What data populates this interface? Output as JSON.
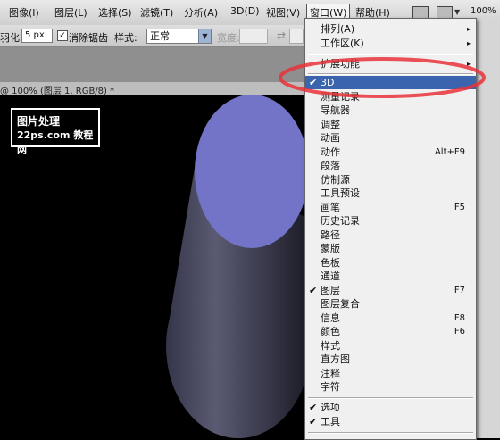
{
  "menubar": {
    "items": [
      "图像(I)",
      "图层(L)",
      "选择(S)",
      "滤镜(T)",
      "分析(A)",
      "3D(D)",
      "视图(V)",
      "窗口(W)",
      "帮助(H)"
    ],
    "zoom": "100%"
  },
  "options": {
    "feather_label": "羽化:",
    "feather_value": "5 px",
    "antialias_label": "消除锯齿",
    "antialias_checked": "✓",
    "style_label": "样式:",
    "style_value": "正常",
    "width_label": "宽度:"
  },
  "document": {
    "tab_title": "@ 100% (图层 1, RGB/8) *"
  },
  "watermark": {
    "line1": "图片处理",
    "line2": "22ps.com 教程网"
  },
  "colors": {
    "highlight": "#3a64ad",
    "cylinder_top": "#7373c8",
    "ellipse_ring": "#e8333a"
  },
  "window_menu": {
    "items": [
      {
        "label": "排列(A)",
        "submenu": "▸"
      },
      {
        "label": "工作区(K)",
        "submenu": "▸"
      },
      {
        "label": "扩展功能",
        "submenu": "▸"
      },
      {
        "label": "3D",
        "check": "✔"
      },
      {
        "label": "测量记录"
      },
      {
        "label": "导航器"
      },
      {
        "label": "调整"
      },
      {
        "label": "动画"
      },
      {
        "label": "动作",
        "shortcut": "Alt+F9"
      },
      {
        "label": "段落"
      },
      {
        "label": "仿制源"
      },
      {
        "label": "工具预设"
      },
      {
        "label": "画笔",
        "shortcut": "F5"
      },
      {
        "label": "历史记录"
      },
      {
        "label": "路径"
      },
      {
        "label": "蒙版"
      },
      {
        "label": "色板"
      },
      {
        "label": "通道"
      },
      {
        "label": "图层",
        "check": "✔",
        "shortcut": "F7"
      },
      {
        "label": "图层复合"
      },
      {
        "label": "信息",
        "shortcut": "F8"
      },
      {
        "label": "颜色",
        "shortcut": "F6"
      },
      {
        "label": "样式"
      },
      {
        "label": "直方图"
      },
      {
        "label": "注释"
      },
      {
        "label": "字符"
      },
      {
        "label": "选项",
        "check": "✔"
      },
      {
        "label": "工具",
        "check": "✔"
      }
    ]
  }
}
